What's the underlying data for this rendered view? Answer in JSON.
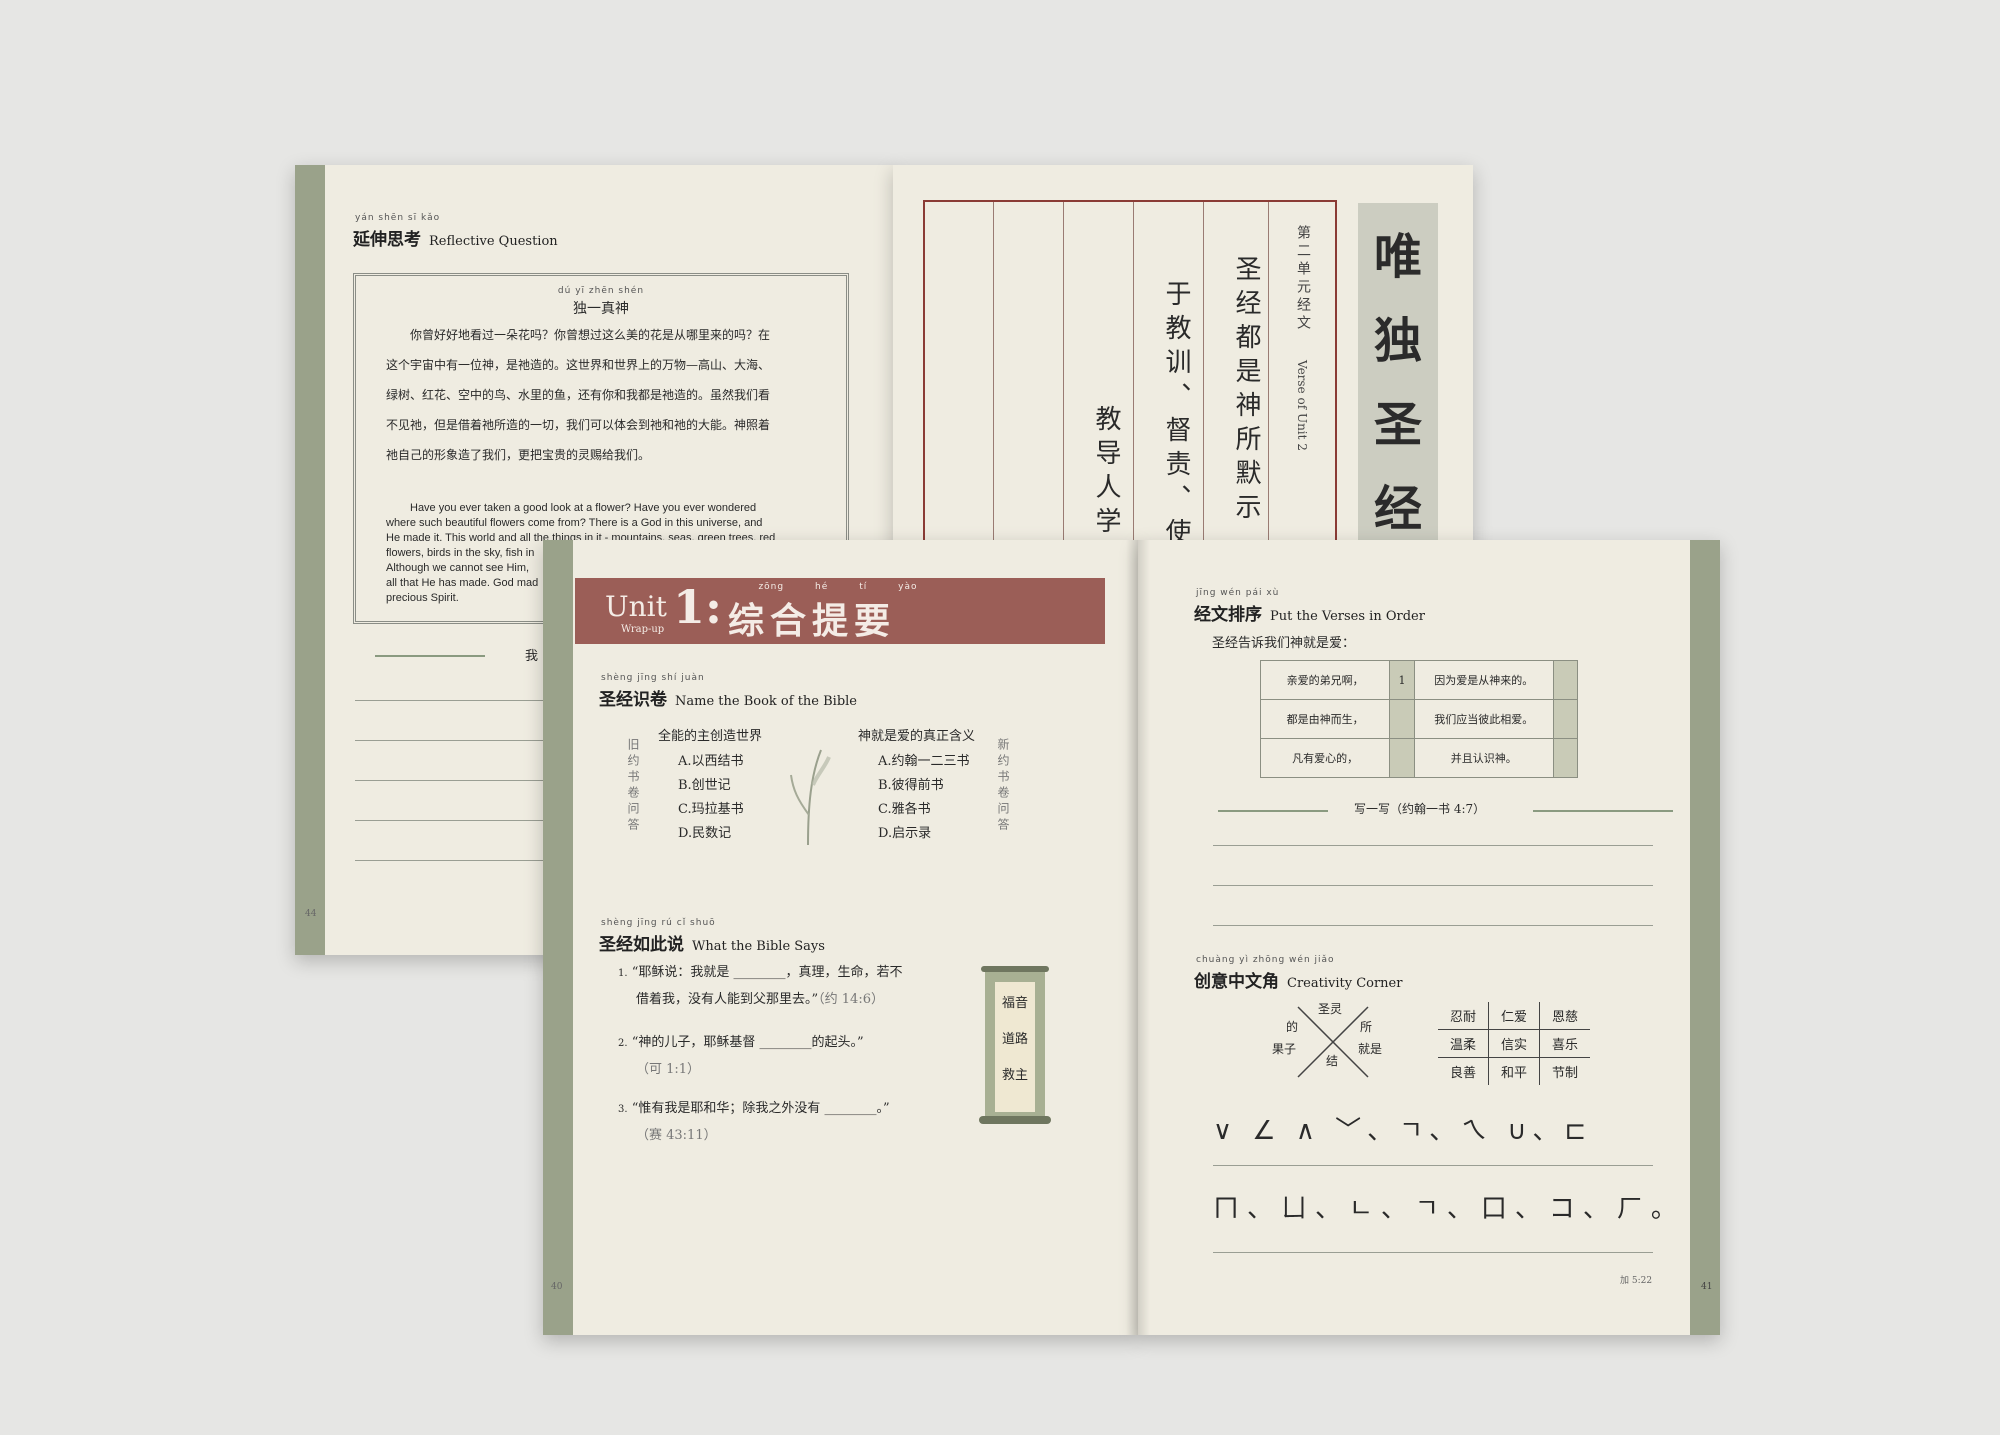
{
  "back_book": {
    "left_page": {
      "heading_pinyin": "yán shēn sī kǎo",
      "heading_zh": "延伸思考",
      "heading_en": "Reflective Question",
      "box_title_pinyin": "dú yī zhēn shén",
      "box_title": "独一真神",
      "zh_lines": [
        "你曾好好地看过一朵花吗？你曾想过这么美的花是从哪里来的吗？在",
        "这个宇宙中有一位神，是祂造的。这世界和世界上的万物—高山、大海、",
        "绿树、红花、空中的鸟、水里的鱼，还有你和我都是祂造的。虽然我们看",
        "不见祂，但是借着祂所造的一切，我们可以体会到祂和祂的大能。神照着",
        "祂自己的形象造了我们，更把宝贵的灵赐给我们。"
      ],
      "en_lines": [
        "Have you ever taken a good look at a flower? Have you ever wondered",
        "where such beautiful flowers come from? There is a God in this universe, and",
        "He made it. This world and all the things in it - mountains, seas, green trees, red",
        "flowers, birds in the sky, fish in",
        "Although we cannot see Him,",
        "all that He has made. God mad",
        "precious Spirit."
      ],
      "divider_char": "我",
      "page_number": "44"
    },
    "right_page": {
      "calligraphy": [
        "唯",
        "独",
        "圣",
        "经"
      ],
      "unit_label_zh": "第二单元经文",
      "unit_label_en": "Verse of Unit 2",
      "verse_columns": [
        "圣经都是神所默示",
        "于教训、督责、使",
        "教导人学"
      ]
    }
  },
  "front_book": {
    "left_page": {
      "banner_unit": "Unit",
      "banner_num": "1",
      "banner_colon": ":",
      "banner_sub": "Wrap-up",
      "banner_pinyin": [
        "zōng",
        "hé",
        "tí",
        "yào"
      ],
      "banner_zh": "综合提要",
      "section1": {
        "pinyin": "shèng jīng shí juàn",
        "zh": "圣经识卷",
        "en": "Name the Book of the Bible",
        "old_label": "旧约书卷问答",
        "new_label": "新约书卷问答",
        "q1": "全能的主创造世界",
        "q1_options": [
          "A.以西结书",
          "B.创世记",
          "C.玛拉基书",
          "D.民数记"
        ],
        "q2": "神就是爱的真正含义",
        "q2_options": [
          "A.约翰一二三书",
          "B.彼得前书",
          "C.雅各书",
          "D.启示录"
        ]
      },
      "section2": {
        "pinyin": "shèng jīng rú cǐ shuō",
        "zh": "圣经如此说",
        "en": "What the Bible Says",
        "items": [
          {
            "num": "1.",
            "line1": "“耶稣说：我就是 ________，真理，生命，若不",
            "line2": "借着我，没有人能到父那里去。”",
            "ref": "（约 14:6）"
          },
          {
            "num": "2.",
            "line1": "“神的儿子，耶稣基督 ________的起头。”",
            "line2": "",
            "ref": "（可 1:1）"
          },
          {
            "num": "3.",
            "line1": "“惟有我是耶和华；除我之外没有 ________。”",
            "line2": "",
            "ref": "（赛 43:11）"
          }
        ],
        "scroll_words": [
          "福音",
          "道路",
          "救主"
        ]
      },
      "page_number": "40"
    },
    "right_page": {
      "section1": {
        "pinyin": "jīng wén pái xù",
        "zh": "经文排序",
        "en": "Put the Verses in Order",
        "prompt": "圣经告诉我们神就是爱：",
        "rows": [
          {
            "left": "亲爱的弟兄啊，",
            "num": "1",
            "right": "因为爱是从神来的。"
          },
          {
            "left": "都是由神而生，",
            "num": "",
            "right": "我们应当彼此相爱。"
          },
          {
            "left": "凡有爱心的，",
            "num": "",
            "right": "并且认识神。"
          }
        ],
        "write_label": "写一写（约翰一书 4:7）"
      },
      "section2": {
        "pinyin": "chuàng yì zhōng wén jiǎo",
        "zh": "创意中文角",
        "en": "Creativity Corner",
        "cross_words": {
          "top": "圣灵",
          "left_top": "的",
          "right_top": "所",
          "left": "果子",
          "bottom": "结",
          "right": "就是"
        },
        "grid": [
          [
            "忍耐",
            "仁爱",
            "恩慈"
          ],
          [
            "温柔",
            "信实",
            "喜乐"
          ],
          [
            "良善",
            "和平",
            "节制"
          ]
        ],
        "shapes_row1": "∨ ∠ ∧ ﹀、ㄱ、ㄟ ∪、⊏",
        "shapes_row2": "ㄇ、ㄩ、ㄴ、ㄱ、口、コ、ㄏ。"
      },
      "verse_ref": "加 5:22",
      "page_number": "41"
    }
  }
}
